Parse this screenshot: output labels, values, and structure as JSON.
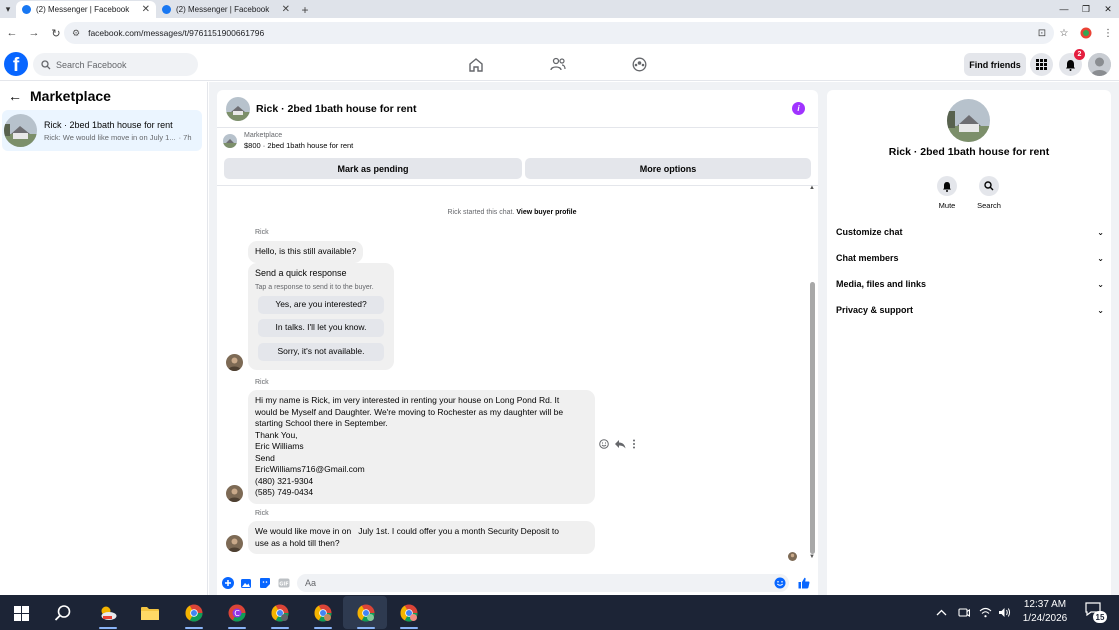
{
  "browser": {
    "tabs": [
      {
        "title": "(2) Messenger | Facebook",
        "active": true
      },
      {
        "title": "(2) Messenger | Facebook",
        "active": false
      }
    ],
    "url": "facebook.com/messages/t/9761151900661796"
  },
  "fb_header": {
    "search_placeholder": "Search Facebook",
    "find_friends": "Find friends",
    "notification_count": "2",
    "logo_letter": "f"
  },
  "sidebar": {
    "title": "Marketplace",
    "conversations": [
      {
        "name": "Rick · 2bed 1bath house for rent",
        "preview": "Rick: We would like move in on July 1...",
        "time": "· 7h"
      }
    ]
  },
  "chat": {
    "title": "Rick · 2bed 1bath house for rent",
    "listing": {
      "label": "Marketplace",
      "detail": "$800 · 2bed 1bath house for rent"
    },
    "actions": {
      "mark_pending": "Mark as pending",
      "more_options": "More options"
    },
    "started_text": "Rick started this chat.",
    "view_profile": "View buyer profile",
    "messages": [
      {
        "sender": "Rick",
        "text": "Hello, is this still available?"
      },
      {
        "sender": "Rick",
        "lines": [
          "Hi my name is Rick, im very interested in renting your house on Long Pond Rd. It",
          "would be Myself and Daughter. We're moving to Rochester as my daughter will be",
          "starting School there in September.",
          "Thank You,",
          "Eric Williams",
          "Send",
          "EricWilliams716@Gmail.com",
          "(480) 321-9304",
          "(585) 749-0434"
        ]
      },
      {
        "sender": "Rick",
        "lines": [
          "We would like move in on   July 1st. I could offer you a month Security Deposit to",
          "use as a hold till then?"
        ]
      }
    ],
    "quick_response": {
      "title": "Send a quick response",
      "subtitle": "Tap a response to send it to the buyer.",
      "options": [
        "Yes, are you interested?",
        "In talks. I'll let you know.",
        "Sorry, it's not available."
      ]
    },
    "composer_placeholder": "Aa"
  },
  "right_panel": {
    "name": "Rick · 2bed 1bath house for rent",
    "actions": [
      "Mute",
      "Search"
    ],
    "sections": [
      "Customize chat",
      "Chat members",
      "Media, files and links",
      "Privacy & support"
    ]
  },
  "taskbar": {
    "time": "12:37 AM",
    "date": "1/24/2026",
    "notifications": "15"
  },
  "colors": {
    "fb_blue": "#0866ff",
    "info_purple": "#a033ff",
    "badge_red": "#e41e3f",
    "selected_convo": "#ebf5ff",
    "taskbar": "#1c2436"
  }
}
